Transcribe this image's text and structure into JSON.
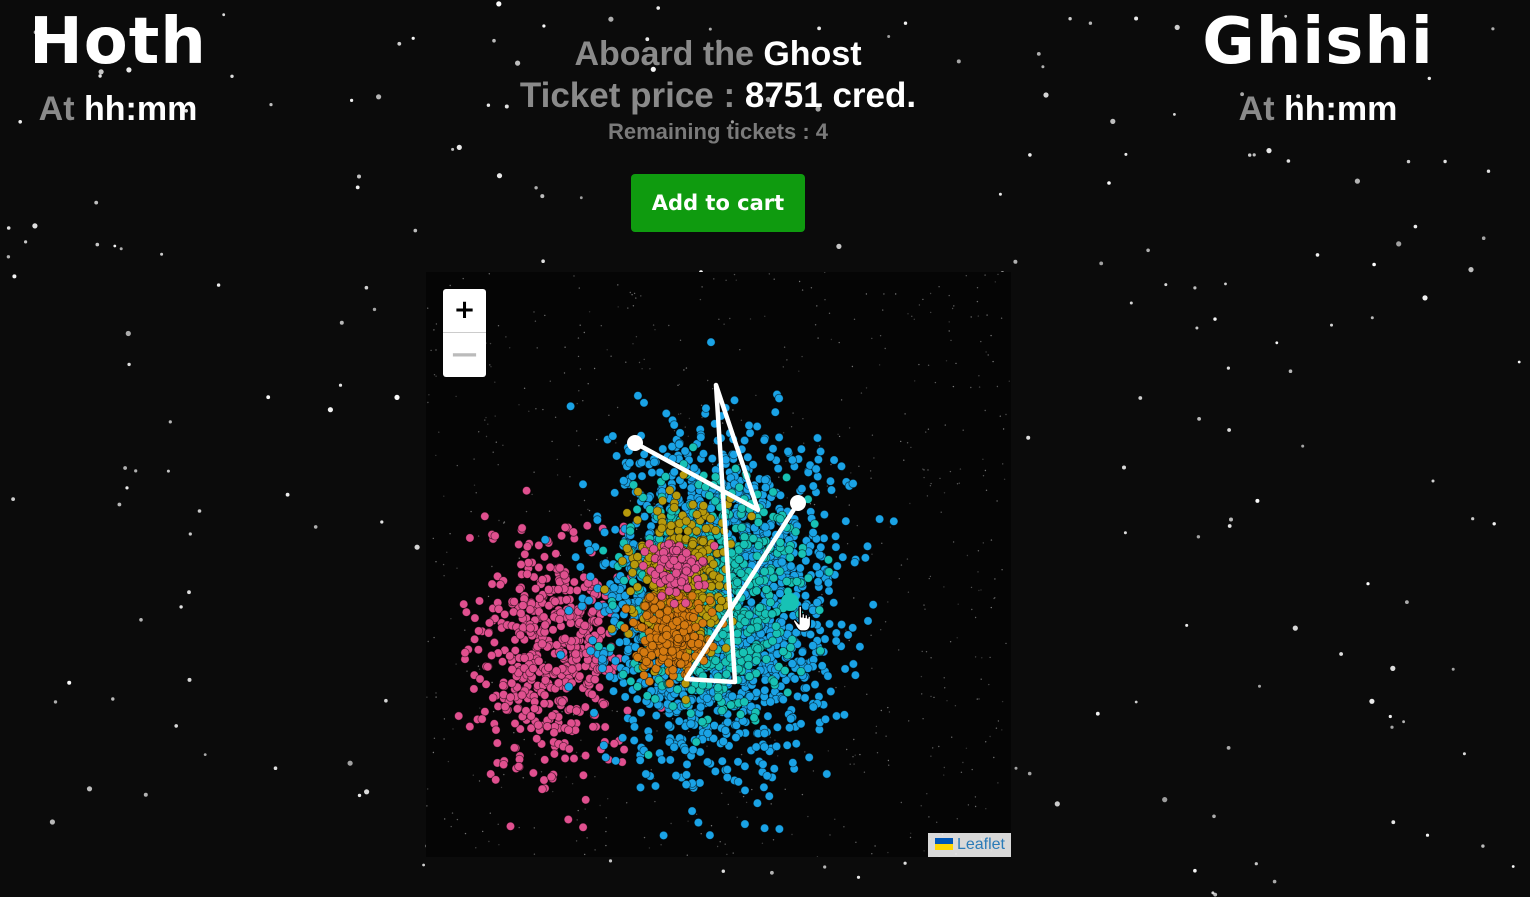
{
  "origin": {
    "name": "Hoth",
    "time_prefix": "At",
    "time": "hh:mm"
  },
  "destination": {
    "name": "Ghishi",
    "time_prefix": "At",
    "time": "hh:mm"
  },
  "trip": {
    "ship_prefix": "Aboard the",
    "ship_name": "Ghost",
    "price_label": "Ticket price :",
    "price_value": "8751 cred.",
    "remaining_label": "Remaining tickets :",
    "remaining_value": "4"
  },
  "cart_button": {
    "label": "Add to cart"
  },
  "map": {
    "zoom_in_label": "+",
    "zoom_out_label": "—",
    "attribution_label": "Leaflet",
    "attribution_icon": "ukraine-flag-icon",
    "cursor_icon": "hand-pointer-icon",
    "colors": {
      "cluster_blue": "#1aa3e6",
      "cluster_teal": "#17c2b5",
      "cluster_gold": "#b79a0c",
      "cluster_orange": "#d47a10",
      "cluster_pink": "#e0508f",
      "route": "#ffffff"
    }
  },
  "colors": {
    "background": "#0b0b0b",
    "accent_green": "#0f9b0f",
    "muted_text": "#8a8a8a",
    "text": "#ffffff"
  }
}
